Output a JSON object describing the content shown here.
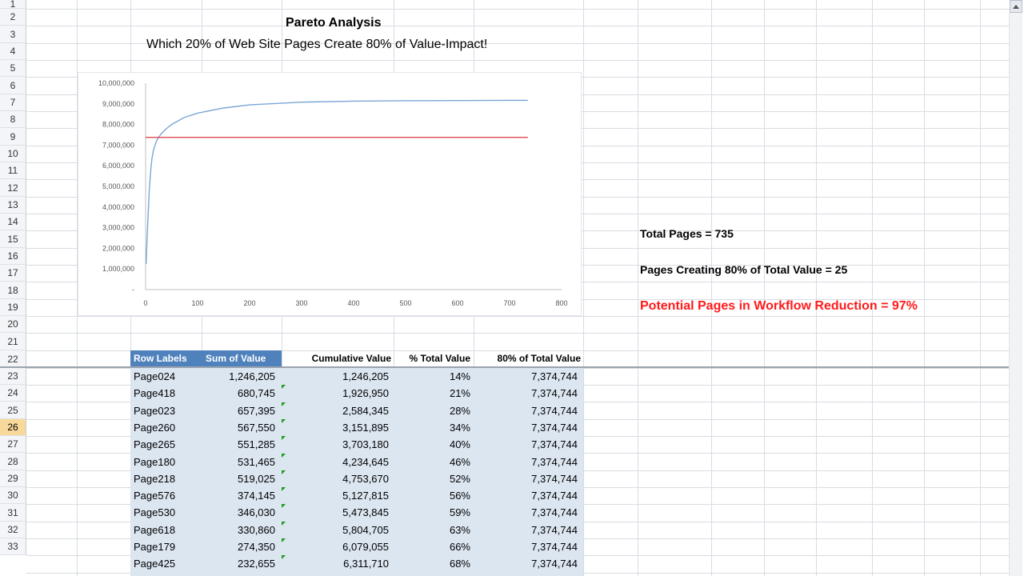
{
  "title": "Pareto Analysis",
  "subtitle": "Which 20% of Web Site Pages Create 80% of Value-Impact!",
  "info": {
    "total_pages": "Total Pages = 735",
    "pages_80": "Pages Creating 80% of Total Value = 25",
    "reduction": "Potential Pages in Workflow Reduction = 97%"
  },
  "colors": {
    "cumulative_line": "#7aa6d6",
    "threshold_line": "#e0474c",
    "header_blue": "#4f81bd",
    "body_fill": "#dce6f1",
    "red_text": "#ff1a1a"
  },
  "row_numbers": [
    "1",
    "2",
    "3",
    "4",
    "5",
    "6",
    "7",
    "8",
    "9",
    "10",
    "11",
    "12",
    "13",
    "14",
    "15",
    "16",
    "17",
    "18",
    "19",
    "20",
    "21",
    "22",
    "23",
    "24",
    "25",
    "26",
    "27",
    "28",
    "29",
    "30",
    "31",
    "32",
    "33"
  ],
  "active_row": "26",
  "table": {
    "headers": [
      "Row Labels",
      "Sum of Value",
      "Cumulative Value",
      "% Total Value",
      "80% of Total Value"
    ],
    "rows": [
      [
        "Page024",
        "1,246,205",
        "1,246,205",
        "14%",
        "7,374,744"
      ],
      [
        "Page418",
        "680,745",
        "1,926,950",
        "21%",
        "7,374,744"
      ],
      [
        "Page023",
        "657,395",
        "2,584,345",
        "28%",
        "7,374,744"
      ],
      [
        "Page260",
        "567,550",
        "3,151,895",
        "34%",
        "7,374,744"
      ],
      [
        "Page265",
        "551,285",
        "3,703,180",
        "40%",
        "7,374,744"
      ],
      [
        "Page180",
        "531,465",
        "4,234,645",
        "46%",
        "7,374,744"
      ],
      [
        "Page218",
        "519,025",
        "4,753,670",
        "52%",
        "7,374,744"
      ],
      [
        "Page576",
        "374,145",
        "5,127,815",
        "56%",
        "7,374,744"
      ],
      [
        "Page530",
        "346,030",
        "5,473,845",
        "59%",
        "7,374,744"
      ],
      [
        "Page618",
        "330,860",
        "5,804,705",
        "63%",
        "7,374,744"
      ],
      [
        "Page179",
        "274,350",
        "6,079,055",
        "66%",
        "7,374,744"
      ],
      [
        "Page425",
        "232,655",
        "6,311,710",
        "68%",
        "7,374,744"
      ]
    ]
  },
  "chart_data": {
    "type": "line",
    "title": "",
    "xlabel": "",
    "ylabel": "",
    "xlim": [
      0,
      800
    ],
    "ylim": [
      0,
      10000000
    ],
    "x_ticks": [
      "0",
      "100",
      "200",
      "300",
      "400",
      "500",
      "600",
      "700",
      "800"
    ],
    "y_ticks": [
      "-",
      "1,000,000",
      "2,000,000",
      "3,000,000",
      "4,000,000",
      "5,000,000",
      "6,000,000",
      "7,000,000",
      "8,000,000",
      "9,000,000",
      "10,000,000"
    ],
    "grid": false,
    "legend": "none",
    "series": [
      {
        "x": [
          1,
          2,
          3,
          4,
          5,
          6,
          7,
          8,
          9,
          10,
          11,
          12,
          15,
          20,
          25,
          30,
          40,
          50,
          75,
          100,
          150,
          200,
          300,
          400,
          500,
          600,
          735
        ],
        "y": [
          1246205,
          1926950,
          2584345,
          3151895,
          3703180,
          4234645,
          4753670,
          5127815,
          5473845,
          5804705,
          6079055,
          6311710,
          6750000,
          7150000,
          7374744,
          7550000,
          7800000,
          8000000,
          8350000,
          8550000,
          8800000,
          8950000,
          9080000,
          9130000,
          9150000,
          9160000,
          9170000
        ]
      },
      {
        "x": [
          0,
          735
        ],
        "y": [
          7374744,
          7374744
        ]
      }
    ]
  }
}
